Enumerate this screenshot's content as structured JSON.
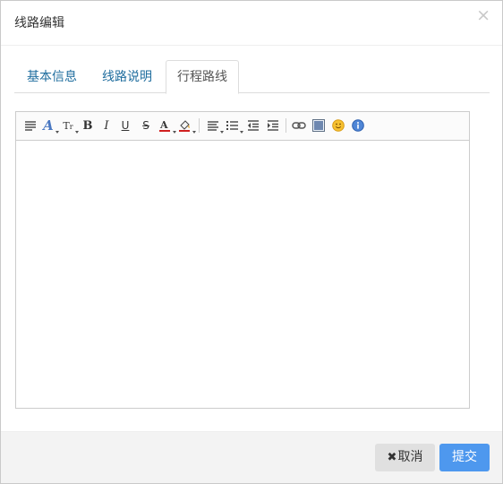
{
  "dialog": {
    "title": "线路编辑",
    "close_icon": "close-icon"
  },
  "tabs": [
    {
      "label": "基本信息",
      "active": false
    },
    {
      "label": "线路说明",
      "active": false
    },
    {
      "label": "行程路线",
      "active": true
    }
  ],
  "editor": {
    "content": "",
    "toolbar": [
      {
        "name": "paragraph-format-icon"
      },
      {
        "name": "font-family-icon"
      },
      {
        "name": "font-size-icon"
      },
      {
        "name": "bold-icon"
      },
      {
        "name": "italic-icon"
      },
      {
        "name": "underline-icon"
      },
      {
        "name": "strikethrough-icon"
      },
      {
        "name": "font-color-icon"
      },
      {
        "name": "background-color-icon"
      },
      {
        "name": "align-icon"
      },
      {
        "name": "list-icon"
      },
      {
        "name": "outdent-icon"
      },
      {
        "name": "indent-icon"
      },
      {
        "name": "link-icon"
      },
      {
        "name": "image-icon"
      },
      {
        "name": "emoji-icon"
      },
      {
        "name": "info-icon"
      }
    ]
  },
  "footer": {
    "cancel_label": "取消",
    "submit_label": "提交"
  },
  "colors": {
    "tab_link": "#1f6d9e",
    "submit_bg": "#4e98ee",
    "cancel_bg": "#e0e0e0",
    "footer_bg": "#f3f3f3"
  }
}
